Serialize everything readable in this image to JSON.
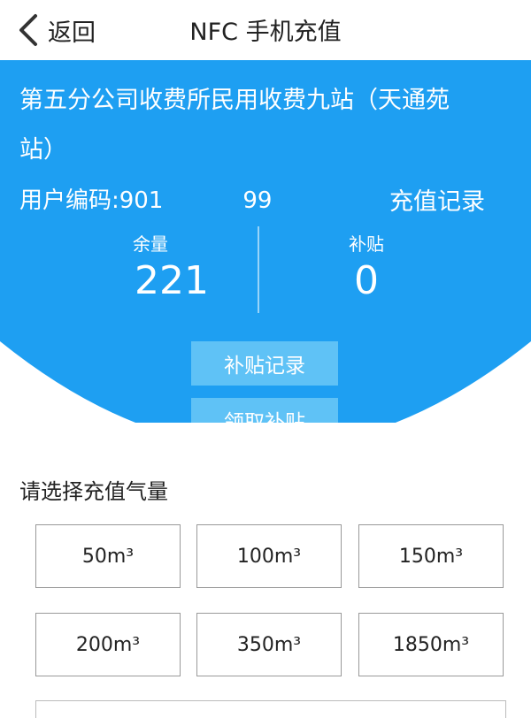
{
  "nav": {
    "back_label": "返回",
    "title": "NFC 手机充值"
  },
  "account": {
    "station_name": "第五分公司收费所民用收费九站（天通苑站）",
    "user_code_label": "用户编码:901",
    "user_code_suffix": "99",
    "recharge_record_label": "充值记录",
    "balance_label": "余量",
    "balance_value": "221",
    "subsidy_label": "补贴",
    "subsidy_value": "0"
  },
  "actions": {
    "subsidy_record": "补贴记录",
    "claim_subsidy": "领取补贴"
  },
  "recharge": {
    "section_title": "请选择充值气量",
    "options": [
      "50m³",
      "100m³",
      "150m³",
      "200m³",
      "350m³",
      "1850m³"
    ]
  },
  "colors": {
    "accent": "#1e9ff2",
    "button_light": "#5fc2f6"
  }
}
